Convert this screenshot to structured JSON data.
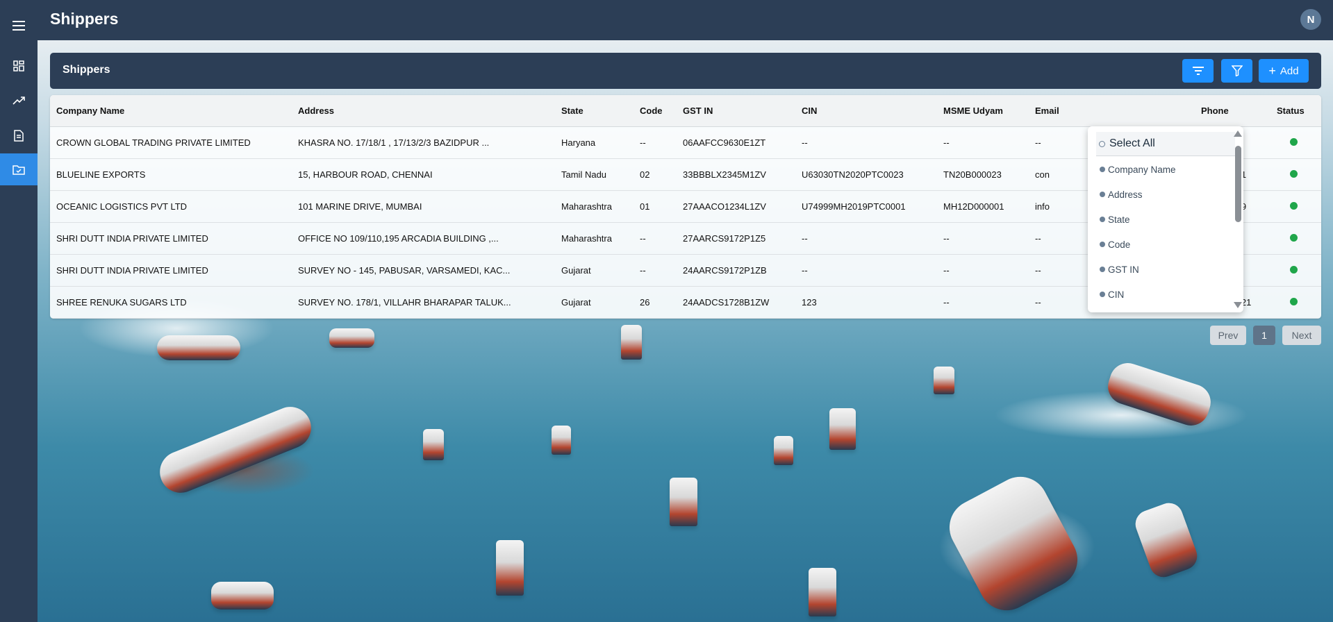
{
  "app": {
    "page_title": "Shippers",
    "user_initial": "N"
  },
  "sidebar": {
    "items": [
      {
        "icon": "menu-icon"
      },
      {
        "icon": "dashboard-icon"
      },
      {
        "icon": "trending-up-icon"
      },
      {
        "icon": "document-icon"
      },
      {
        "icon": "folder-check-icon",
        "active": true
      }
    ]
  },
  "section": {
    "title": "Shippers",
    "add_label": "Add"
  },
  "table": {
    "columns": [
      "Company Name",
      "Address",
      "State",
      "Code",
      "GST IN",
      "CIN",
      "MSME Udyam",
      "Email",
      "Phone",
      "Status"
    ],
    "rows": [
      [
        "CROWN GLOBAL TRADING PRIVATE LIMITED",
        "KHASRA NO. 17/18/1 , 17/13/2/3 BAZIDPUR ...",
        "Haryana",
        "--",
        "06AAFCC9630E1ZT",
        "--",
        "--",
        "--",
        "--"
      ],
      [
        "BLUELINE EXPORTS",
        "15, HARBOUR ROAD, CHENNAI",
        "Tamil Nadu",
        "02",
        "33BBBLX2345M1ZV",
        "U63030TN2020PTC0023",
        "TN20B000023",
        "con",
        "345678901"
      ],
      [
        "OCEANIC LOGISTICS PVT LTD",
        "101 MARINE DRIVE, MUMBAI",
        "Maharashtra",
        "01",
        "27AAACO1234L1ZV",
        "U74999MH2019PTC0001",
        "MH12D000001",
        "info",
        "123456789"
      ],
      [
        "SHRI DUTT INDIA PRIVATE LIMITED",
        "OFFICE NO 109/110,195 ARCADIA BUILDING ,...",
        "Maharashtra",
        "--",
        "27AARCS9172P1Z5",
        "--",
        "--",
        "--",
        "--"
      ],
      [
        "SHRI DUTT INDIA PRIVATE LIMITED",
        "SURVEY NO - 145, PABUSAR, VARSAMEDI, KAC...",
        "Gujarat",
        "--",
        "24AARCS9172P1ZB",
        "--",
        "--",
        "--",
        "--"
      ],
      [
        "SHREE RENUKA SUGARS LTD",
        "SURVEY NO. 178/1, VILLAHR BHARAPAR TALUK...",
        "Gujarat",
        "26",
        "24AADCS1728B1ZW",
        "123",
        "--",
        "--",
        "0987654321"
      ]
    ]
  },
  "column_menu": {
    "select_all": "Select All",
    "options": [
      "Company Name",
      "Address",
      "State",
      "Code",
      "GST IN",
      "CIN"
    ]
  },
  "pagination": {
    "prev": "Prev",
    "current": "1",
    "next": "Next"
  },
  "colors": {
    "nav": "#2c3e56",
    "accent": "#1e90ff",
    "status_active": "#1fa64a"
  }
}
